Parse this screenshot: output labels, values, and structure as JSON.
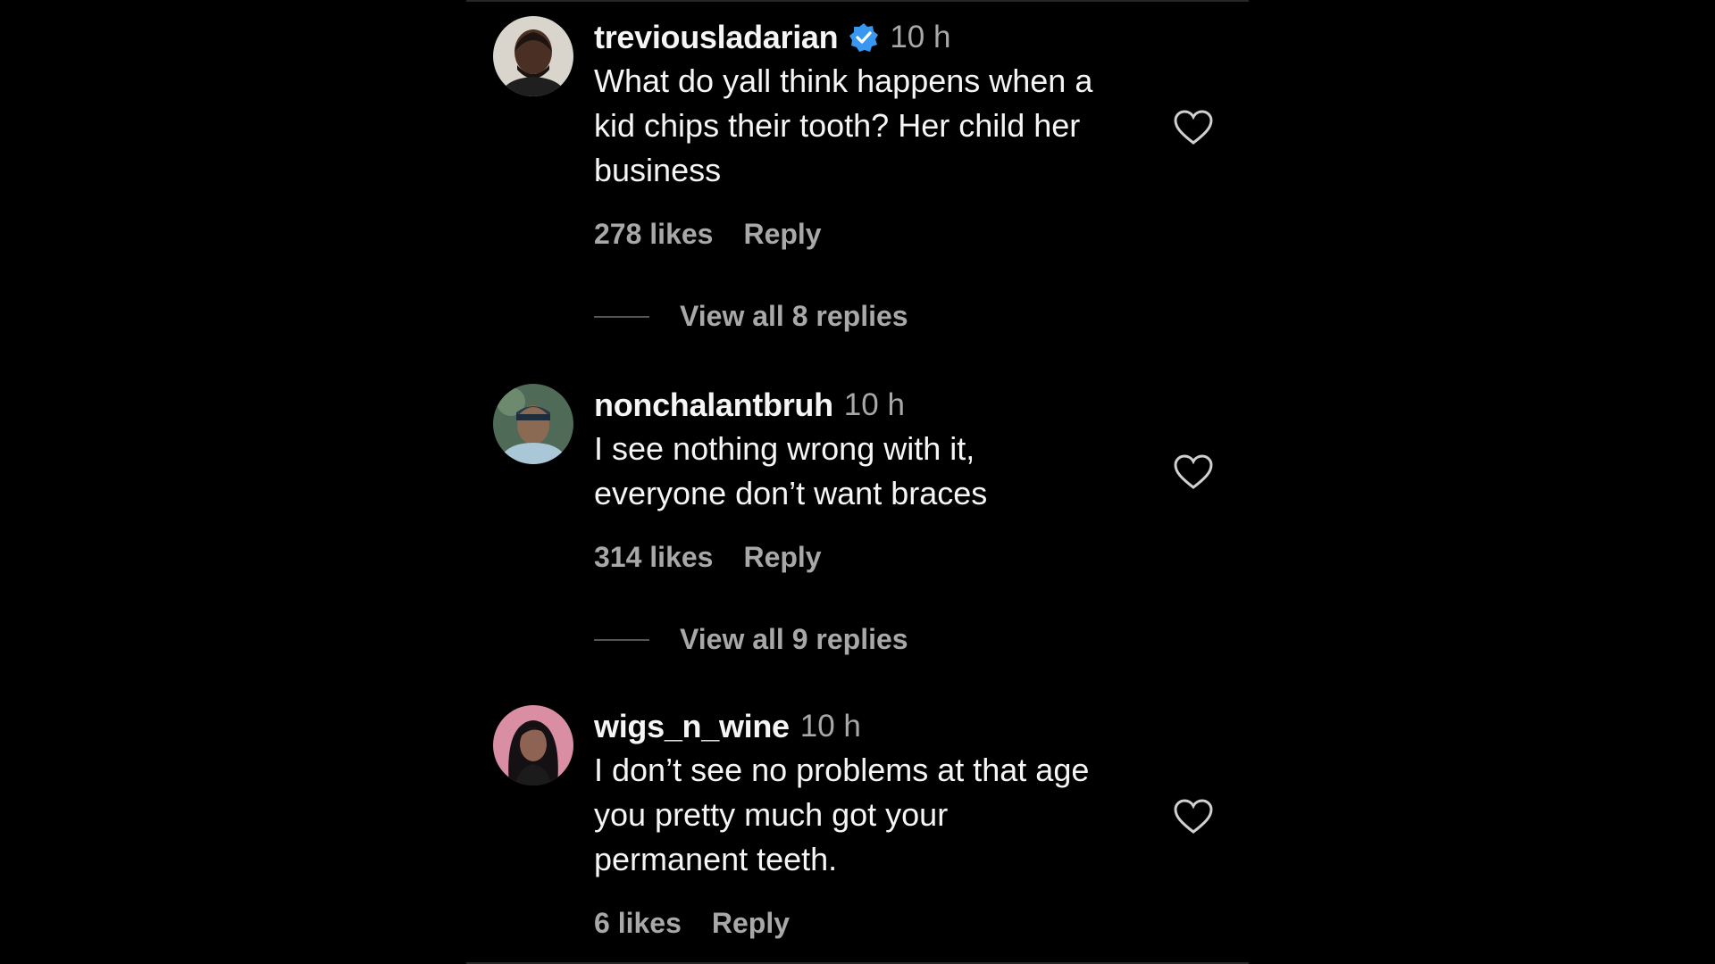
{
  "colors": {
    "background": "#000000",
    "text_primary": "#f5f5f5",
    "text_secondary": "#a8a8a8",
    "verified_badge": "#3897f0",
    "divider": "#262626"
  },
  "comments": [
    {
      "username": "treviousladarian",
      "verified": true,
      "time": "10 h",
      "text": "What do yall think happens when a\nkid chips their tooth? Her child her\nbusiness",
      "likes": "278 likes",
      "reply_label": "Reply",
      "view_replies": "View all 8 replies",
      "avatar_icon": "man-portrait-avatar"
    },
    {
      "username": "nonchalantbruh",
      "verified": false,
      "time": "10 h",
      "text": "I see nothing wrong with it,\neveryone don’t want braces",
      "likes": "314 likes",
      "reply_label": "Reply",
      "view_replies": "View all 9 replies",
      "avatar_icon": "man-cap-avatar"
    },
    {
      "username": "wigs_n_wine",
      "verified": false,
      "time": "10 h",
      "text": "I don’t see no problems at that age\nyou pretty much got your\npermanent teeth.",
      "likes": "6 likes",
      "reply_label": "Reply",
      "avatar_icon": "woman-portrait-avatar"
    }
  ],
  "icons": {
    "heart": "heart-outline-icon",
    "verified": "verified-badge-icon"
  }
}
